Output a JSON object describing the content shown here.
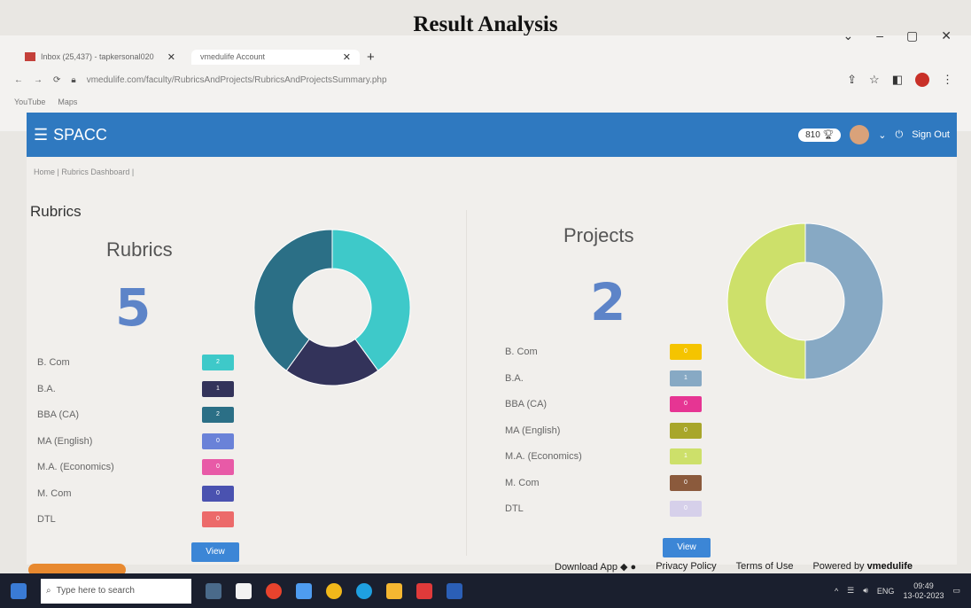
{
  "caption": "Result Analysis",
  "browser": {
    "tabs": [
      {
        "label": "Inbox (25,437) - tapkersonal020",
        "close": "✕"
      },
      {
        "label": "vmedulife Account",
        "close": "✕"
      }
    ],
    "new_tab": "+",
    "url": "vmedulife.com/faculty/RubricsAndProjects/RubricsAndProjectsSummary.php",
    "bookmarks": [
      "YouTube",
      "Maps"
    ],
    "window_controls": [
      "⌄",
      "–",
      "▢",
      "✕"
    ]
  },
  "navbar": {
    "brand": "SPACC",
    "points": "810",
    "signout": "Sign Out",
    "color": "#2f79c0"
  },
  "breadcrumb": "Home | Rubrics Dashboard |",
  "section_title": "Rubrics",
  "rubrics_panel": {
    "title": "Rubrics",
    "count": "5",
    "legend": [
      {
        "label": "B. Com",
        "value": "2",
        "color": "#3ec9c9"
      },
      {
        "label": "B.A.",
        "value": "1",
        "color": "#33335a"
      },
      {
        "label": "BBA (CA)",
        "value": "2",
        "color": "#2b6f86"
      },
      {
        "label": "MA (English)",
        "value": "0",
        "color": "#6a82d8"
      },
      {
        "label": "M.A. (Economics)",
        "value": "0",
        "color": "#e85aa7"
      },
      {
        "label": "M. Com",
        "value": "0",
        "color": "#4a52b0"
      },
      {
        "label": "DTL",
        "value": "0",
        "color": "#ec6a6a"
      }
    ],
    "view": "View"
  },
  "projects_panel": {
    "title": "Projects",
    "count": "2",
    "legend": [
      {
        "label": "B. Com",
        "value": "0",
        "color": "#f5c400"
      },
      {
        "label": "B.A.",
        "value": "1",
        "color": "#87a9c4"
      },
      {
        "label": "BBA (CA)",
        "value": "0",
        "color": "#e63593"
      },
      {
        "label": "MA (English)",
        "value": "0",
        "color": "#a8a62a"
      },
      {
        "label": "M.A. (Economics)",
        "value": "1",
        "color": "#cde06a"
      },
      {
        "label": "M. Com",
        "value": "0",
        "color": "#8b5a3c"
      },
      {
        "label": "DTL",
        "value": "0",
        "color": "#d6d0ea"
      }
    ],
    "view": "View"
  },
  "footer": {
    "download": "Download App",
    "privacy": "Privacy Policy",
    "terms": "Terms of Use",
    "powered": "Powered by",
    "brand": "vmedulife"
  },
  "taskbar": {
    "search": "Type here to search",
    "lang": "ENG",
    "time": "09:49",
    "date": "13-02-2023"
  }
}
